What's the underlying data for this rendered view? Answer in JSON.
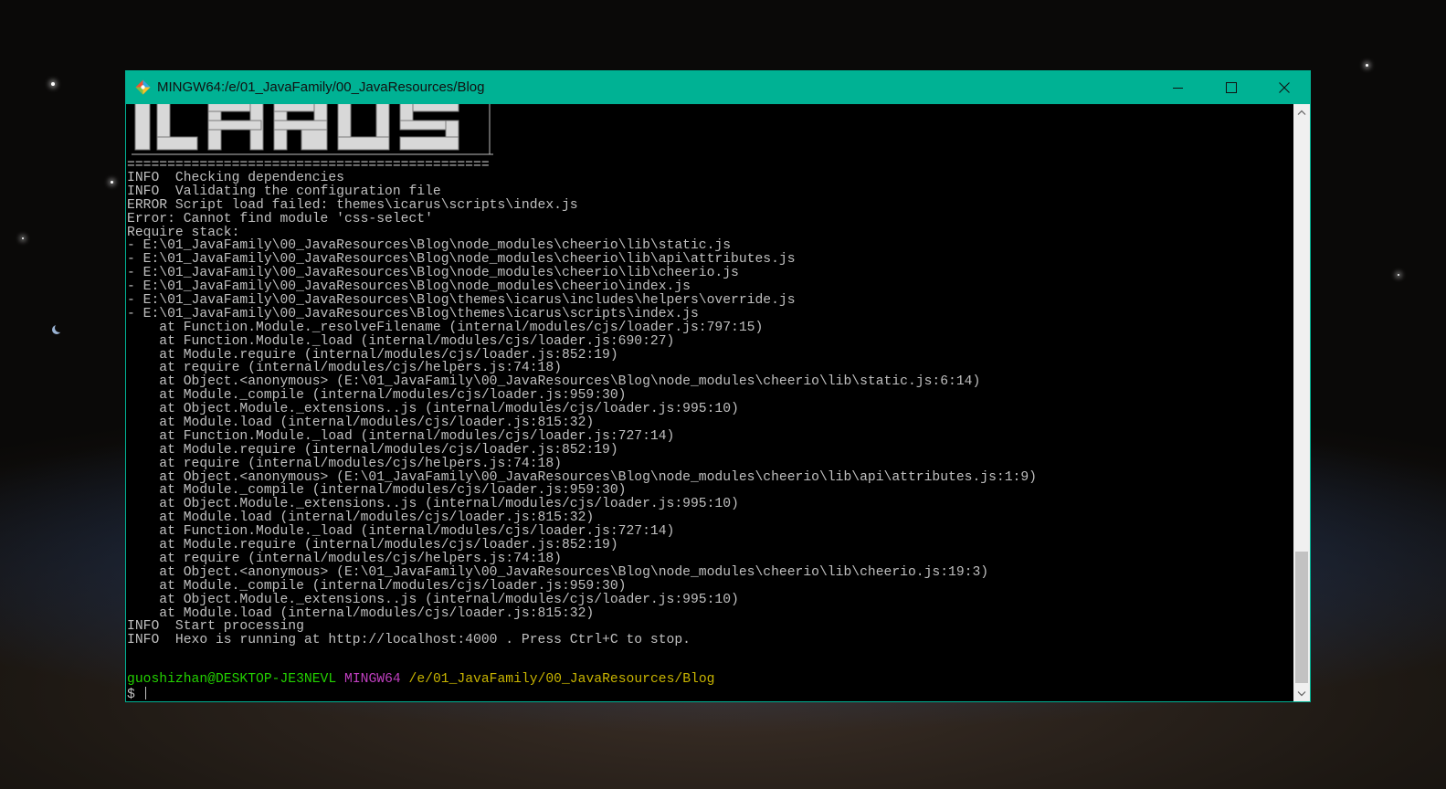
{
  "window": {
    "title": "MINGW64:/e/01_JavaFamily/00_JavaResources/Blog",
    "accent_color": "#00b294",
    "icon": "git-bash-icon",
    "controls": [
      "minimize-icon",
      "maximize-icon",
      "close-icon"
    ]
  },
  "terminal": {
    "banner_icon": "icarus-ascii-banner",
    "rule": "=============================================",
    "lines": [
      "INFO  Checking dependencies",
      "INFO  Validating the configuration file",
      "ERROR Script load failed: themes\\icarus\\scripts\\index.js",
      "Error: Cannot find module 'css-select'",
      "Require stack:",
      "- E:\\01_JavaFamily\\00_JavaResources\\Blog\\node_modules\\cheerio\\lib\\static.js",
      "- E:\\01_JavaFamily\\00_JavaResources\\Blog\\node_modules\\cheerio\\lib\\api\\attributes.js",
      "- E:\\01_JavaFamily\\00_JavaResources\\Blog\\node_modules\\cheerio\\lib\\cheerio.js",
      "- E:\\01_JavaFamily\\00_JavaResources\\Blog\\node_modules\\cheerio\\index.js",
      "- E:\\01_JavaFamily\\00_JavaResources\\Blog\\themes\\icarus\\includes\\helpers\\override.js",
      "- E:\\01_JavaFamily\\00_JavaResources\\Blog\\themes\\icarus\\scripts\\index.js",
      "    at Function.Module._resolveFilename (internal/modules/cjs/loader.js:797:15)",
      "    at Function.Module._load (internal/modules/cjs/loader.js:690:27)",
      "    at Module.require (internal/modules/cjs/loader.js:852:19)",
      "    at require (internal/modules/cjs/helpers.js:74:18)",
      "    at Object.<anonymous> (E:\\01_JavaFamily\\00_JavaResources\\Blog\\node_modules\\cheerio\\lib\\static.js:6:14)",
      "    at Module._compile (internal/modules/cjs/loader.js:959:30)",
      "    at Object.Module._extensions..js (internal/modules/cjs/loader.js:995:10)",
      "    at Module.load (internal/modules/cjs/loader.js:815:32)",
      "    at Function.Module._load (internal/modules/cjs/loader.js:727:14)",
      "    at Module.require (internal/modules/cjs/loader.js:852:19)",
      "    at require (internal/modules/cjs/helpers.js:74:18)",
      "    at Object.<anonymous> (E:\\01_JavaFamily\\00_JavaResources\\Blog\\node_modules\\cheerio\\lib\\api\\attributes.js:1:9)",
      "    at Module._compile (internal/modules/cjs/loader.js:959:30)",
      "    at Object.Module._extensions..js (internal/modules/cjs/loader.js:995:10)",
      "    at Module.load (internal/modules/cjs/loader.js:815:32)",
      "    at Function.Module._load (internal/modules/cjs/loader.js:727:14)",
      "    at Module.require (internal/modules/cjs/loader.js:852:19)",
      "    at require (internal/modules/cjs/helpers.js:74:18)",
      "    at Object.<anonymous> (E:\\01_JavaFamily\\00_JavaResources\\Blog\\node_modules\\cheerio\\lib\\cheerio.js:19:3)",
      "    at Module._compile (internal/modules/cjs/loader.js:959:30)",
      "    at Object.Module._extensions..js (internal/modules/cjs/loader.js:995:10)",
      "    at Module.load (internal/modules/cjs/loader.js:815:32)",
      "INFO  Start processing",
      "INFO  Hexo is running at http://localhost:4000 . Press Ctrl+C to stop."
    ],
    "prompt": {
      "user_host": "guoshizhan@DESKTOP-JE3NEVL",
      "system": "MINGW64",
      "path": "/e/01_JavaFamily/00_JavaResources/Blog",
      "symbol": "$",
      "user_color": "#23d100",
      "system_color": "#c03fc0",
      "path_color": "#c8b400"
    }
  },
  "scrollbar": {
    "up_icon": "scroll-up-arrow-icon",
    "down_icon": "scroll-down-arrow-icon",
    "scroll_position_fraction": 0.92
  }
}
